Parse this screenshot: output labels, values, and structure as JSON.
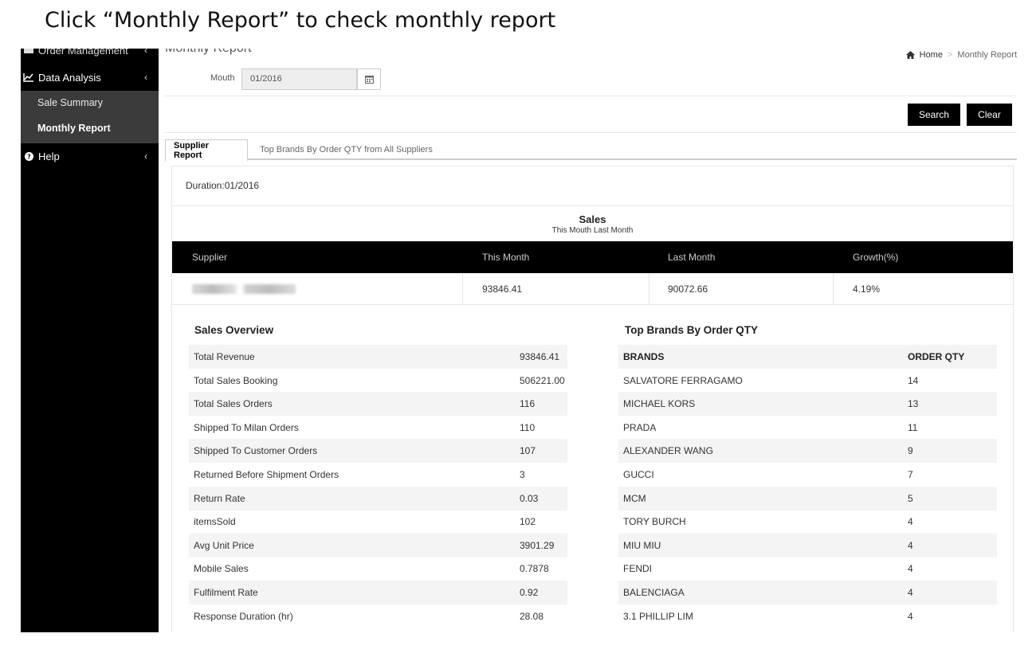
{
  "caption": "Click  “Monthly Report”  to check monthly report",
  "sidebar": {
    "top_item": "Order Management",
    "data_analysis": "Data Analysis",
    "sub_items": [
      "Sale Summary",
      "Monthly Report"
    ],
    "help": "Help",
    "chevron": "‹"
  },
  "page": {
    "title": "Monthly Report",
    "breadcrumb": {
      "home": "Home",
      "separator": ">",
      "current": "Monthly Report"
    }
  },
  "filter": {
    "month_label": "Mouth",
    "month_value": "01/2016"
  },
  "buttons": {
    "search": "Search",
    "clear": "Clear"
  },
  "tabs": [
    "Supplier Report",
    "Top Brands By Order QTY from All Suppliers"
  ],
  "report": {
    "duration": "Duration:01/2016",
    "sales_title": "Sales",
    "sales_subtitle": "This Mouth Last Month",
    "columns": [
      "Supplier",
      "This Month",
      "Last Month",
      "Growth(%)"
    ],
    "row": {
      "this_month": "93846.41",
      "last_month": "90072.66",
      "growth": "4.19%"
    }
  },
  "overview": {
    "title": "Sales Overview",
    "rows": [
      [
        "Total Revenue",
        "93846.41"
      ],
      [
        "Total Sales Booking",
        "506221.00"
      ],
      [
        "Total Sales Orders",
        "116"
      ],
      [
        "Shipped To Milan Orders",
        "110"
      ],
      [
        "Shipped To Customer Orders",
        "107"
      ],
      [
        "Returned Before Shipment Orders",
        "3"
      ],
      [
        "Return Rate",
        "0.03"
      ],
      [
        "itemsSold",
        "102"
      ],
      [
        "Avg Unit Price",
        "3901.29"
      ],
      [
        "Mobile Sales",
        "0.7878"
      ],
      [
        "Fulfilment Rate",
        "0.92"
      ],
      [
        "Response Duration (hr)",
        "28.08"
      ]
    ]
  },
  "brands": {
    "title": "Top Brands By Order QTY",
    "header": [
      "BRANDS",
      "ORDER QTY"
    ],
    "rows": [
      [
        "SALVATORE FERRAGAMO",
        "14"
      ],
      [
        "MICHAEL KORS",
        "13"
      ],
      [
        "PRADA",
        "11"
      ],
      [
        "ALEXANDER WANG",
        "9"
      ],
      [
        "GUCCI",
        "7"
      ],
      [
        "MCM",
        "5"
      ],
      [
        "TORY BURCH",
        "4"
      ],
      [
        "MIU MIU",
        "4"
      ],
      [
        "FENDI",
        "4"
      ],
      [
        "BALENCIAGA",
        "4"
      ],
      [
        "3.1 PHILLIP LIM",
        "4"
      ]
    ]
  }
}
